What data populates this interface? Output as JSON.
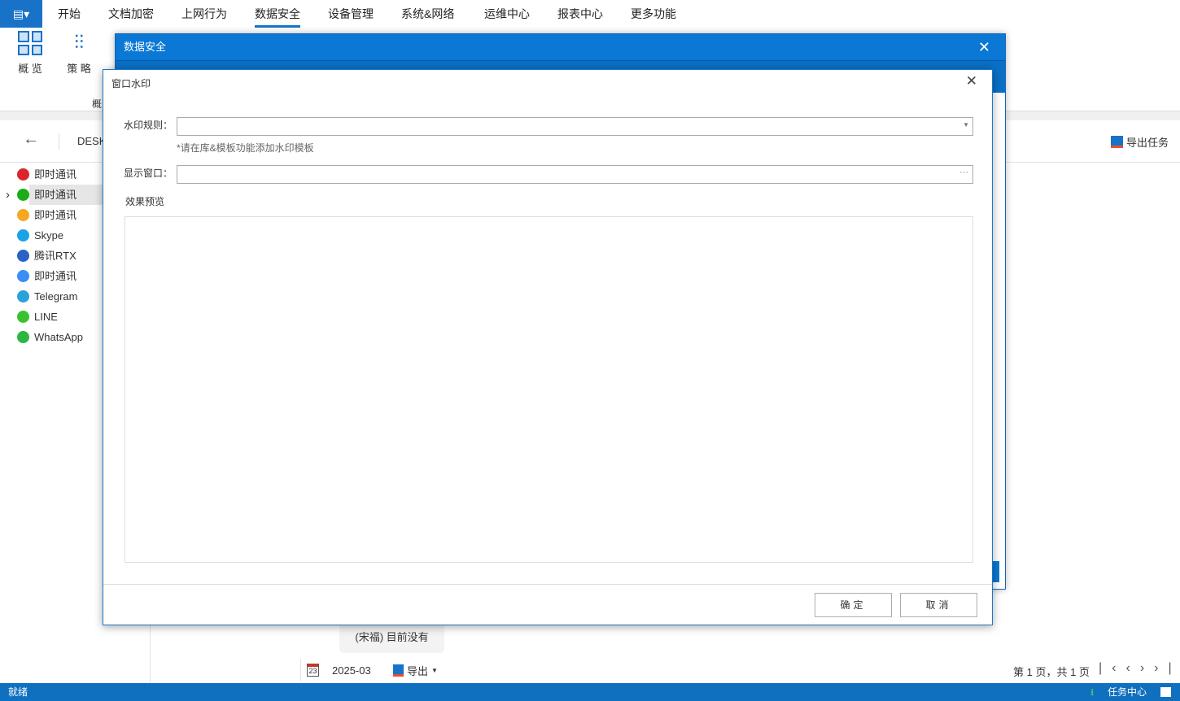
{
  "menubar": {
    "tabs": [
      "开始",
      "文档加密",
      "上网行为",
      "数据安全",
      "设备管理",
      "系统&网络",
      "运维中心",
      "报表中心",
      "更多功能"
    ],
    "active": "数据安全"
  },
  "ribbon": {
    "overview": "概 览",
    "policy": "策 略",
    "group_label": "概"
  },
  "toolbar": {
    "path": "DESK",
    "export_task": "导出任务"
  },
  "sidebar": {
    "items": [
      {
        "label": "即时通讯",
        "icon": "im-q-icon",
        "color": "#d9262c"
      },
      {
        "label": "即时通讯",
        "icon": "wechat-work-icon",
        "color": "#1aad19",
        "selected": true
      },
      {
        "label": "即时通讯",
        "icon": "w-icon",
        "color": "#f5a623"
      },
      {
        "label": "Skype",
        "icon": "skype-icon",
        "color": "#1aa2e6"
      },
      {
        "label": "腾讯RTX",
        "icon": "rtx-icon",
        "color": "#2b62c8"
      },
      {
        "label": "即时通讯",
        "icon": "dingtalk-icon",
        "color": "#3b8ef5"
      },
      {
        "label": "Telegram",
        "icon": "telegram-icon",
        "color": "#2aa1da"
      },
      {
        "label": "LINE",
        "icon": "line-icon",
        "color": "#3ac130"
      },
      {
        "label": "WhatsApp",
        "icon": "whatsapp-icon",
        "color": "#2cb742"
      }
    ]
  },
  "background": {
    "message": "(宋福) 目前没有",
    "date": "2025-03",
    "export": "导出",
    "pagination": "第 1 页，共 1 页"
  },
  "statusbar": {
    "status": "就绪",
    "task_center": "任务中心"
  },
  "dialog_outer": {
    "title": "数据安全"
  },
  "dialog": {
    "title": "窗口水印",
    "rule_label": "水印规则：",
    "rule_value": "",
    "hint": "*请在库&模板功能添加水印模板",
    "window_label": "显示窗口：",
    "window_value": "",
    "preview_label": "效果预览",
    "ok": "确定",
    "cancel": "取消"
  }
}
